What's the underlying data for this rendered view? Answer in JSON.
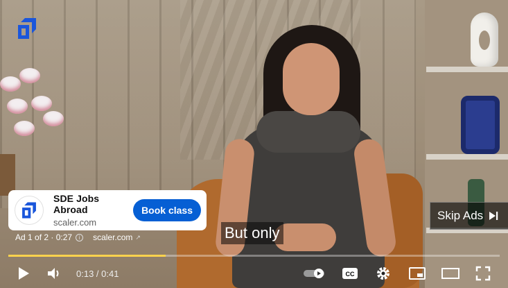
{
  "ad": {
    "title": "SDE Jobs Abroad",
    "domain": "scaler.com",
    "cta_label": "Book class",
    "meta_position": "Ad 1 of 2 · 0:27",
    "meta_link": "scaler.com",
    "skip_label": "Skip Ads"
  },
  "subtitle": {
    "text": "But only"
  },
  "player": {
    "time_display": "0:13 / 0:41",
    "progress_fraction": 0.32,
    "accent_color": "#fcd34d"
  },
  "controls": {
    "icons": [
      "play-icon",
      "volume-icon",
      "autoplay-toggle-icon",
      "captions-icon",
      "settings-icon",
      "miniplayer-icon",
      "theater-icon",
      "fullscreen-icon"
    ],
    "captions_label": "CC"
  },
  "colors": {
    "cta_blue": "#065fd4",
    "brand_blue": "#1a56db"
  }
}
